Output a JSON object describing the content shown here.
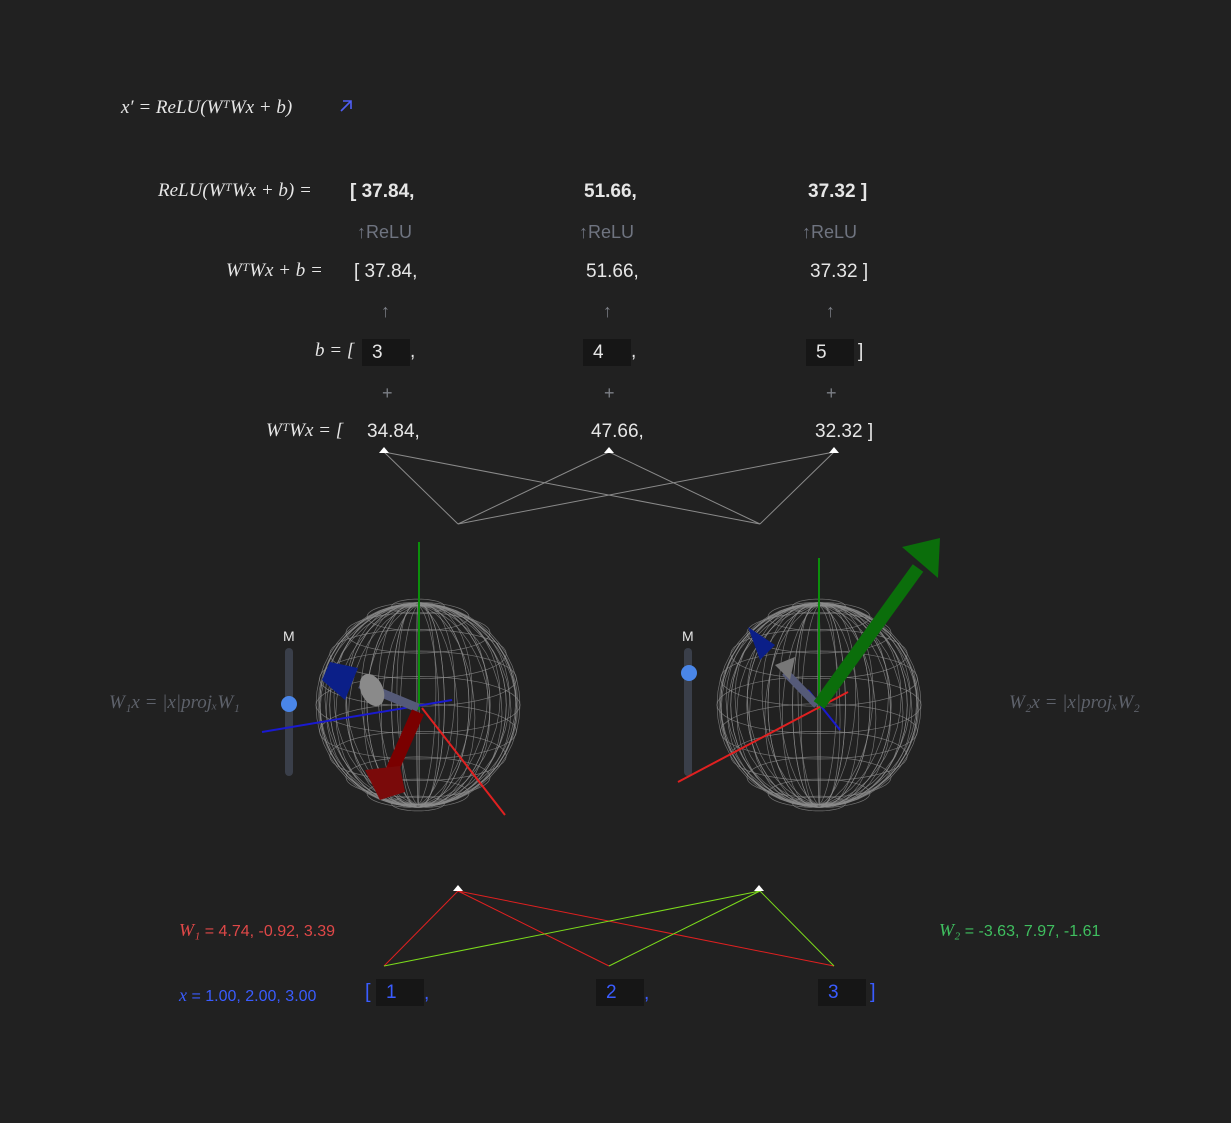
{
  "formula": {
    "lhs": "x′",
    "rhs": "ReLU(WᵀWx + b)",
    "link_icon": "arrow-up-right-icon"
  },
  "relu_row": {
    "label": "ReLU(WᵀWx + b) =",
    "v1": "[ 37.84,",
    "v2": "51.66,",
    "v3": "37.32 ]"
  },
  "relu_arrows": {
    "a1": "↑ReLU",
    "a2": "↑ReLU",
    "a3": "↑ReLU"
  },
  "sum_row": {
    "label": "WᵀWx + b =",
    "v1": "[ 37.84,",
    "v2": "51.66,",
    "v3": "37.32 ]"
  },
  "up_arrows": {
    "a1": "↑",
    "a2": "↑",
    "a3": "↑"
  },
  "bias_row": {
    "label": "b = [",
    "b1": "3",
    "sep1": ",",
    "b2": "4",
    "sep2": ",",
    "b3": "5",
    "close": "]"
  },
  "plus_signs": {
    "p1": "+",
    "p2": "+",
    "p3": "+"
  },
  "wtwx_row": {
    "label": "WᵀWx = [",
    "v1": "34.84,",
    "v2": "47.66,",
    "v3": "32.32 ]"
  },
  "proj_labels": {
    "left": "W₁x = |x|projₓW₁",
    "right": "W₂x = |x|projₓW₂"
  },
  "sliders": {
    "left": {
      "label": "M",
      "value": 0.57
    },
    "right": {
      "label": "M",
      "value": 0.85
    }
  },
  "weights": {
    "w1_label": "W₁",
    "w1_values": "= 4.74, -0.92, 3.39",
    "w2_label": "W₂",
    "w2_values": "= -3.63, 7.97, -1.61",
    "w1_color": "#e04848",
    "w2_color": "#3fbf5f"
  },
  "x_row": {
    "label": "x",
    "values": "= 1.00, 2.00, 3.00",
    "open": "[",
    "x1": "1",
    "sep1": ",",
    "x2": "2",
    "sep2": ",",
    "x3": "3",
    "close": "]",
    "color": "#3a5cff"
  }
}
